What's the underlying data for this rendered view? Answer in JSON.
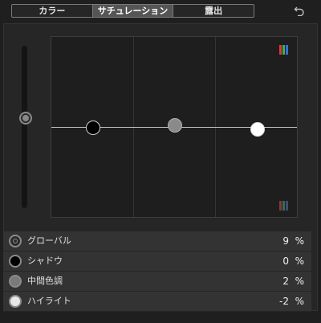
{
  "tabs": [
    {
      "label": "カラー",
      "active": false
    },
    {
      "label": "サチュレーション",
      "active": true
    },
    {
      "label": "露出",
      "active": false
    }
  ],
  "undo_icon": "undo-icon",
  "ranges": [
    {
      "name": "グローバル",
      "value": "9",
      "unit": "%",
      "icon": "global-range-icon"
    },
    {
      "name": "シャドウ",
      "value": "0",
      "unit": "%",
      "icon": "shadows-range-icon"
    },
    {
      "name": "中間色調",
      "value": "2",
      "unit": "%",
      "icon": "midtones-range-icon"
    },
    {
      "name": "ハイライト",
      "value": "-2",
      "unit": "%",
      "icon": "highlights-range-icon"
    }
  ],
  "colors": {
    "shadows": "#000000",
    "midtones": "#8a8a8a",
    "highlights": "#ffffff",
    "rgb": [
      "#d93a3a",
      "#3ab54a",
      "#3a6fd9"
    ],
    "rgb_dim": [
      "#7a3c3c",
      "#3f6a45",
      "#3c4f7a"
    ]
  }
}
